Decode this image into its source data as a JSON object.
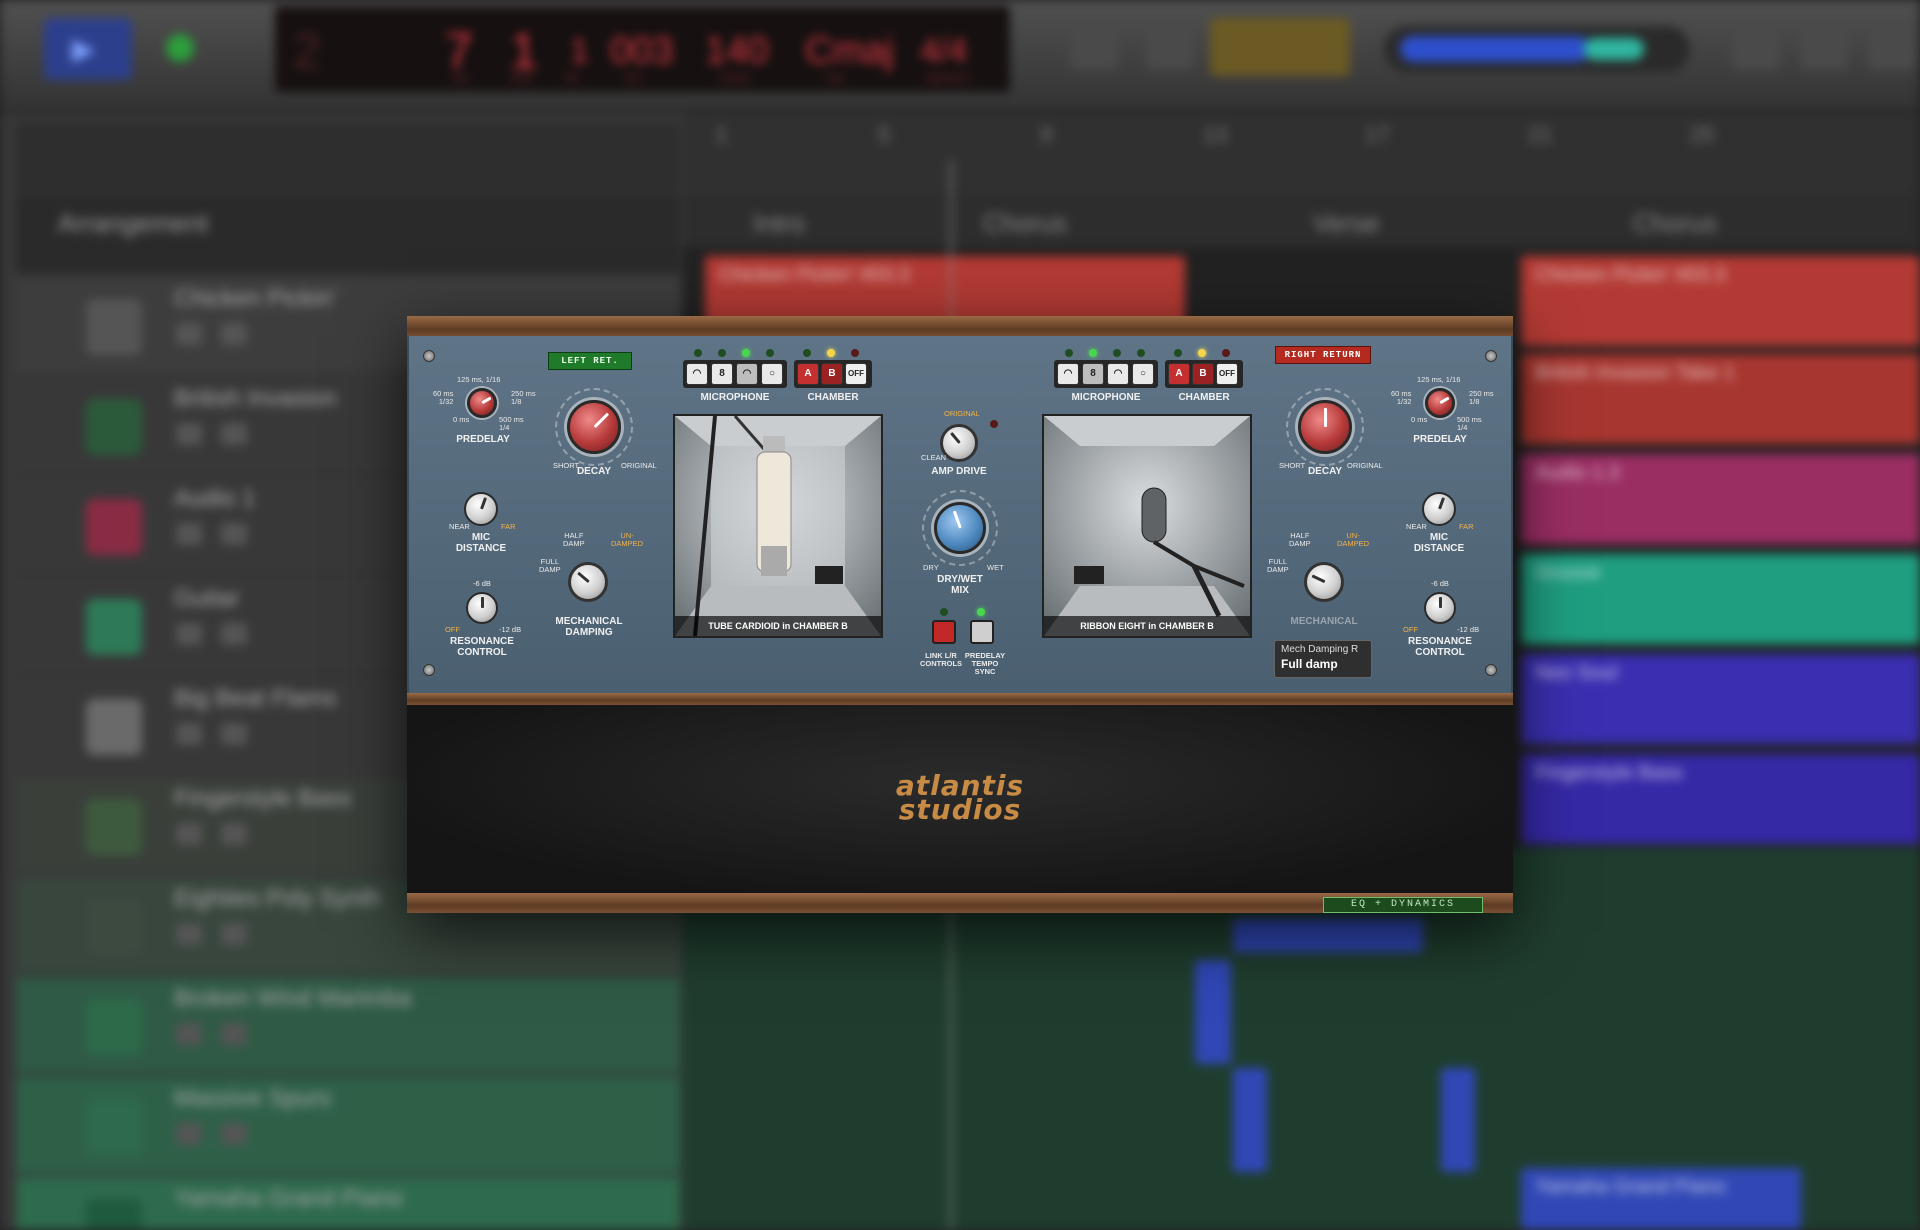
{
  "background": {
    "lcd": {
      "bars": "7",
      "beats": "1",
      "div": "1",
      "tick": "003",
      "tempo": "140",
      "key": "Cmaj",
      "sig": "4/4",
      "l_bar": "bar",
      "l_beat": "beat",
      "l_div": "div",
      "l_tick": "tick",
      "l_tempo": "tempo",
      "l_key": "key",
      "l_sig": "signature"
    },
    "arrangement_label": "Arrangement",
    "ruler": [
      "1",
      "5",
      "9",
      "13",
      "17",
      "21",
      "25"
    ],
    "markers": [
      "Intro",
      "Chorus",
      "Verse",
      "Chorus"
    ],
    "tracks": [
      "Chicken Pickin'",
      "British Invasion",
      "Audio 1",
      "Guitar",
      "Big Beat Flams",
      "Fingerstyle Bass",
      "Eighties Poly Synth",
      "Broken Wind Marimba",
      "Massive Spurs",
      "Yamaha Grand Piano"
    ],
    "regions": [
      "Chicken Pickin' #03.3",
      "Chicken Pickin' #03.3",
      "British Invasion Take 1",
      "Audio 1.3",
      "Groove",
      "Neo Soul",
      "Fingerstyle Bass",
      "Yamaha Grand Piano"
    ]
  },
  "plugin": {
    "left": {
      "return_label": "LEFT RET.",
      "microphone_label": "MICROPHONE",
      "chamber_label": "CHAMBER",
      "mic_buttons": [
        "◠",
        "8",
        "◠",
        "○"
      ],
      "chamber_buttons": [
        "A",
        "B",
        "OFF"
      ],
      "predelay": {
        "label": "PREDELAY",
        "t_top": "125 ms, 1/16",
        "t_left": "60 ms\n1/32",
        "t_right": "250 ms\n1/8",
        "t_bl": "0 ms",
        "t_br": "500 ms\n1/4"
      },
      "decay": {
        "label": "DECAY",
        "short": "SHORT",
        "original": "ORIGINAL"
      },
      "mic_distance": {
        "label": "MIC\nDISTANCE",
        "near": "NEAR",
        "far": "FAR"
      },
      "mech_damping": {
        "label": "MECHANICAL\nDAMPING",
        "full": "FULL\nDAMP",
        "half": "HALF\nDAMP",
        "un": "UN-\nDAMPED"
      },
      "resonance": {
        "label": "RESONANCE\nCONTROL",
        "top": "-6 dB",
        "off": "OFF",
        "low": "-12 dB"
      },
      "photo_caption": "TUBE CARDIOID in CHAMBER B"
    },
    "center": {
      "amp_drive": {
        "label": "AMP DRIVE",
        "original": "ORIGINAL",
        "clean": "CLEAN"
      },
      "drywet": {
        "label": "DRY/WET\nMIX",
        "dry": "DRY",
        "wet": "WET"
      },
      "link": "LINK L/R\nCONTROLS",
      "tempo_sync": "PREDELAY\nTEMPO\nSYNC"
    },
    "right": {
      "return_label": "RIGHT RETURN",
      "microphone_label": "MICROPHONE",
      "chamber_label": "CHAMBER",
      "mic_buttons": [
        "◠",
        "8",
        "◠",
        "○"
      ],
      "chamber_buttons": [
        "A",
        "B",
        "OFF"
      ],
      "predelay": {
        "label": "PREDELAY",
        "t_top": "125 ms, 1/16",
        "t_left": "60 ms\n1/32",
        "t_right": "250 ms\n1/8",
        "t_bl": "0 ms",
        "t_br": "500 ms\n1/4"
      },
      "decay": {
        "label": "DECAY",
        "short": "SHORT",
        "original": "ORIGINAL"
      },
      "mic_distance": {
        "label": "MIC\nDISTANCE",
        "near": "NEAR",
        "far": "FAR"
      },
      "mech_damping": {
        "label": "MECHANICAL",
        "full": "FULL\nDAMP",
        "half": "HALF\nDAMP",
        "un": "UN-\nDAMPED"
      },
      "resonance": {
        "label": "RESONANCE\nCONTROL",
        "top": "-6 dB",
        "off": "OFF",
        "low": "-12 dB"
      },
      "photo_caption": "RIBBON EIGHT in CHAMBER B"
    },
    "tooltip": {
      "title": "Mech Damping R",
      "value": "Full damp"
    },
    "brand": {
      "line1": "atlantis",
      "line2": "studios"
    },
    "eq_button": "EQ + DYNAMICS"
  }
}
